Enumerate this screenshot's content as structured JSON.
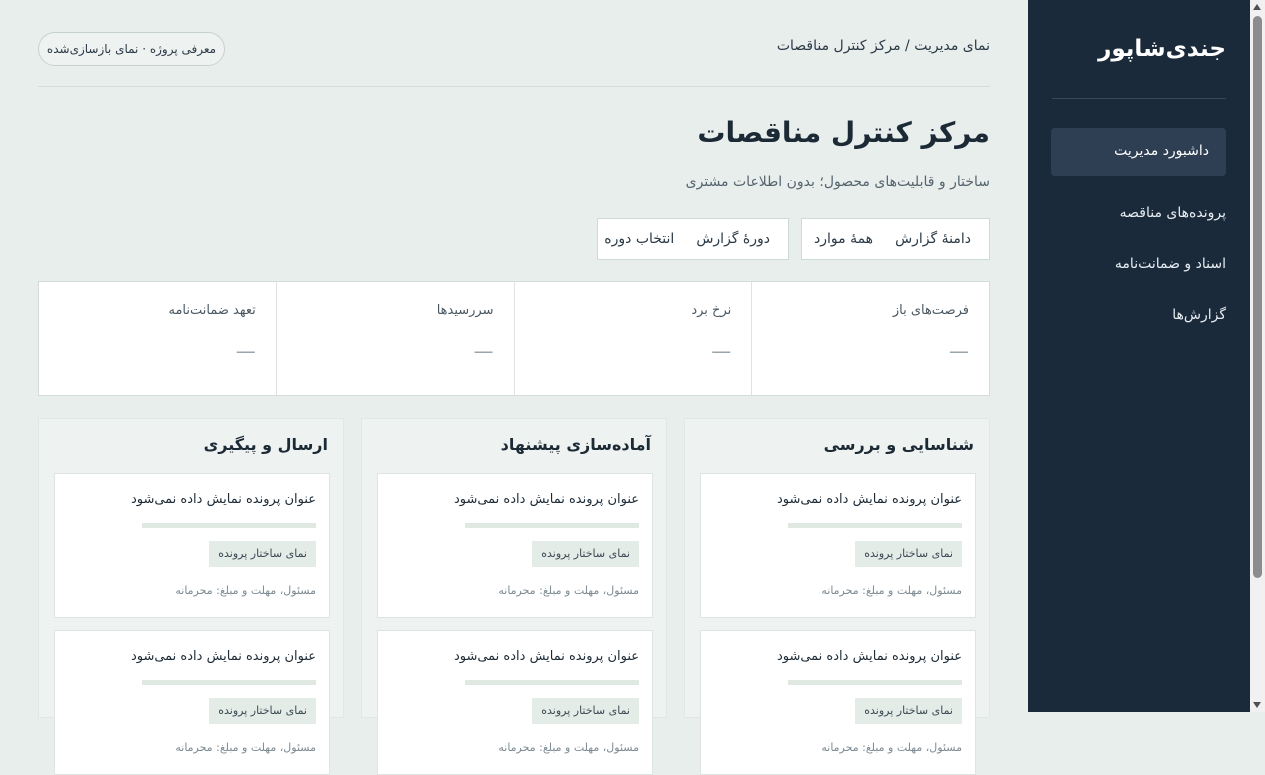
{
  "sidebar": {
    "brand": "جندی‌شاپور",
    "items": [
      {
        "label": "داشبورد مدیریت",
        "active": true
      },
      {
        "label": "پرونده‌های مناقصه"
      },
      {
        "label": "اسناد و ضمانت‌نامه"
      },
      {
        "label": "گزارش‌ها"
      }
    ]
  },
  "header": {
    "breadcrumb": "نمای مدیریت / مرکز کنترل مناقصات",
    "project_pill": "معرفی پروژه · نمای بازسازی‌شده"
  },
  "page": {
    "title": "مرکز کنترل مناقصات",
    "subtitle": "ساختار و قابلیت‌های محصول؛ بدون اطلاعات مشتری"
  },
  "filters": {
    "scope": {
      "label": "دامنهٔ گزارش",
      "value": "همهٔ موارد"
    },
    "period": {
      "label": "دورهٔ گزارش",
      "value": "انتخاب دوره"
    }
  },
  "kpis": [
    {
      "label": "فرصت‌های باز",
      "value": "—"
    },
    {
      "label": "نرخ برد",
      "value": "—"
    },
    {
      "label": "سررسیدها",
      "value": "—"
    },
    {
      "label": "تعهد ضمانت‌نامه",
      "value": "—"
    }
  ],
  "columns": [
    {
      "title": "شناسایی و بررسی",
      "cards": [
        {
          "title": "عنوان پرونده نمایش داده نمی‌شود",
          "tag": "نمای ساختار پرونده",
          "meta": "مسئول، مهلت و مبلغ: محرمانه"
        },
        {
          "title": "عنوان پرونده نمایش داده نمی‌شود",
          "tag": "نمای ساختار پرونده",
          "meta": "مسئول، مهلت و مبلغ: محرمانه"
        }
      ]
    },
    {
      "title": "آماده‌سازی پیشنهاد",
      "cards": [
        {
          "title": "عنوان پرونده نمایش داده نمی‌شود",
          "tag": "نمای ساختار پرونده",
          "meta": "مسئول، مهلت و مبلغ: محرمانه"
        },
        {
          "title": "عنوان پرونده نمایش داده نمی‌شود",
          "tag": "نمای ساختار پرونده",
          "meta": "مسئول، مهلت و مبلغ: محرمانه"
        }
      ]
    },
    {
      "title": "ارسال و پیگیری",
      "cards": [
        {
          "title": "عنوان پرونده نمایش داده نمی‌شود",
          "tag": "نمای ساختار پرونده",
          "meta": "مسئول، مهلت و مبلغ: محرمانه"
        },
        {
          "title": "عنوان پرونده نمایش داده نمی‌شود",
          "tag": "نمای ساختار پرونده",
          "meta": "مسئول، مهلت و مبلغ: محرمانه"
        }
      ]
    }
  ],
  "colors": {
    "sidebar_bg": "#1b2a3b",
    "sidebar_active_bg": "#2e3f53",
    "page_bg": "#e8eeec",
    "tag_bg": "#e4ece8",
    "progress_track": "#dfe8e1"
  }
}
